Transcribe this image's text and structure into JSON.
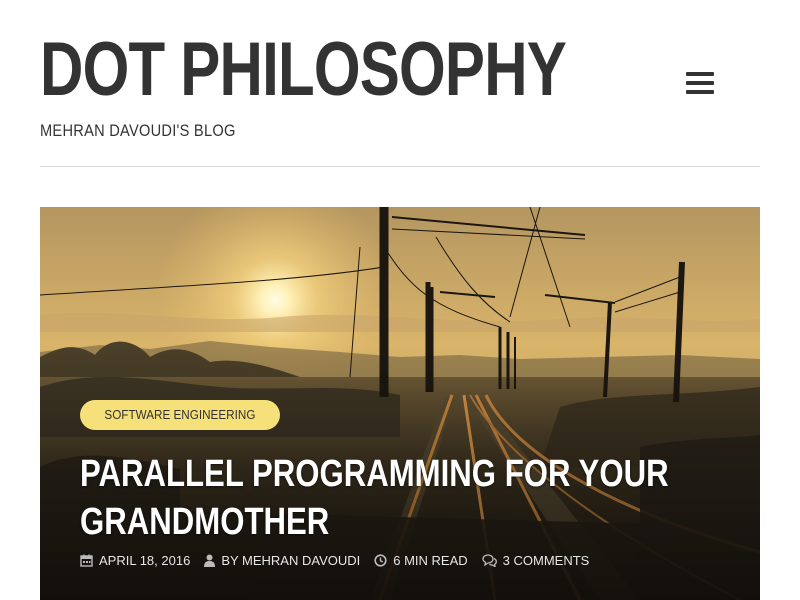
{
  "site": {
    "title": "DOT PHILOSOPHY",
    "tagline": "MEHRAN DAVOUDI'S BLOG"
  },
  "menu": {
    "icon": "hamburger-menu-icon"
  },
  "colors": {
    "text": "#333333",
    "badge_bg": "#f6e07a",
    "meta_text": "#e6e6e6"
  },
  "featured_post": {
    "category": "SOFTWARE ENGINEERING",
    "title_lines": [
      "PARALLEL PROGRAMMING FOR YOUR",
      "GRANDMOTHER"
    ],
    "date": "APRIL 18, 2016",
    "author": "BY MEHRAN DAVOUDI",
    "read_time": "6 MIN READ",
    "comments": "3 COMMENTS",
    "icons": [
      "calendar-icon",
      "user-icon",
      "clock-icon",
      "comments-icon"
    ]
  }
}
